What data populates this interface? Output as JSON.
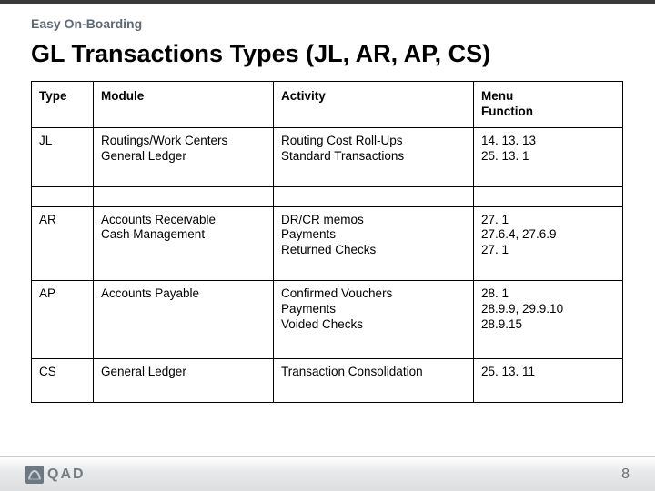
{
  "header": {
    "eyebrow": "Easy On-Boarding",
    "title": "GL Transactions Types (JL, AR, AP, CS)"
  },
  "table": {
    "headers": [
      "Type",
      "Module",
      "Activity",
      "Menu\nFunction"
    ],
    "rows": [
      {
        "type": "JL",
        "module": "Routings/Work Centers\nGeneral Ledger",
        "activity": "Routing Cost Roll-Ups\nStandard Transactions",
        "menu": "14. 13. 13\n25. 13. 1"
      },
      {
        "spacer": true
      },
      {
        "type": "AR",
        "module": "Accounts Receivable\nCash Management",
        "activity": "DR/CR memos\nPayments\nReturned Checks",
        "menu": "27. 1\n27.6.4, 27.6.9\n27. 1"
      },
      {
        "type": "AP",
        "module": "Accounts Payable",
        "activity": "Confirmed Vouchers\nPayments\nVoided Checks",
        "menu": "28. 1\n28.9.9, 29.9.10\n28.9.15"
      },
      {
        "type": "CS",
        "module": "General Ledger",
        "activity": "Transaction Consolidation",
        "menu": "25. 13. 11"
      }
    ]
  },
  "footer": {
    "brand": "QAD",
    "page": "8"
  }
}
